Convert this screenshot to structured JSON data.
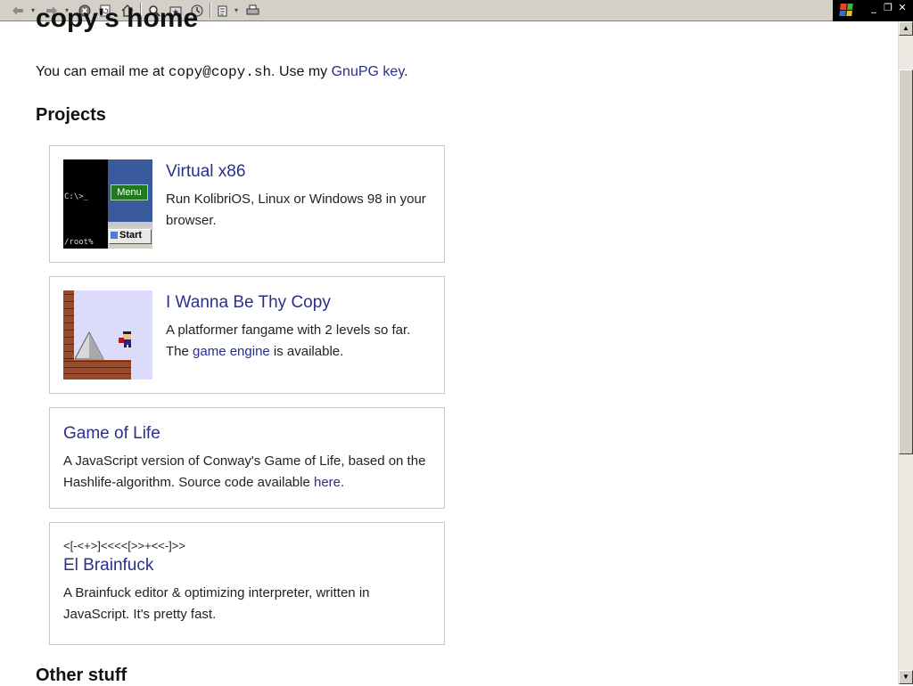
{
  "toolbar": {
    "buttons": [
      "back-icon",
      "forward-icon",
      "stop-icon",
      "refresh-icon",
      "home-icon",
      "search-icon",
      "favorites-icon",
      "history-icon",
      "edit-icon",
      "print-icon"
    ],
    "window_controls": [
      "_",
      "❐",
      "✕"
    ]
  },
  "page": {
    "title": "copy's home",
    "intro_prefix": "You can email me at ",
    "email": "copy@copy.sh",
    "intro_middle": ". Use my ",
    "gnupg_link": "GnuPG key",
    "intro_suffix": "."
  },
  "projects": {
    "heading": "Projects",
    "items": [
      {
        "title": "Virtual x86",
        "desc": "Run KolibriOS, Linux or Windows 98 in your browser.",
        "thumb": {
          "prompt": "C:\\>_",
          "menu": "Menu",
          "root": "/root%",
          "start": "Start"
        }
      },
      {
        "title": "I Wanna Be Thy Copy",
        "desc_prefix": "A platformer fangame with 2 levels so far. The ",
        "desc_link": "game engine",
        "desc_suffix": " is available."
      },
      {
        "title": "Game of Life",
        "desc_prefix": "A JavaScript version of Conway's Game of Life, based on the Hashlife-algorithm. Source code available ",
        "desc_link": "here",
        "desc_suffix": "."
      },
      {
        "code": "<[-<+>]<<<<[>>+<<-]>>",
        "title": "El Brainfuck",
        "desc": "A Brainfuck editor & optimizing interpreter, written in JavaScript. It's pretty fast."
      }
    ]
  },
  "other": {
    "heading": "Other stuff"
  },
  "colors": {
    "link": "#2a2f8a",
    "card_border": "#c8c8c8",
    "toolbar_bg": "#d4d0c8"
  }
}
